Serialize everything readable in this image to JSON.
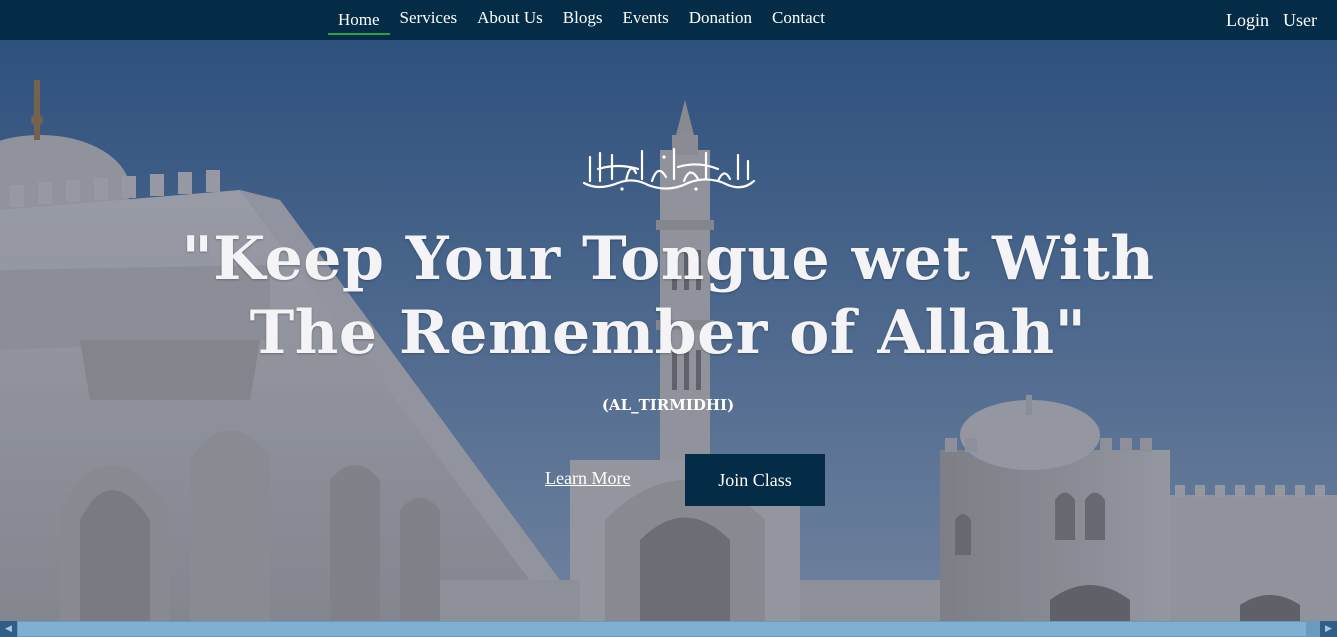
{
  "nav": {
    "items": [
      {
        "label": "Home",
        "active": true
      },
      {
        "label": "Services"
      },
      {
        "label": "About Us"
      },
      {
        "label": "Blogs"
      },
      {
        "label": "Events"
      },
      {
        "label": "Donation"
      },
      {
        "label": "Contact"
      }
    ],
    "login": "Login",
    "user": "User"
  },
  "hero": {
    "headline": "\"Keep Your Tongue wet With The Remember of Allah\"",
    "source": "(AL_TIRMIDHI)",
    "learn_more": "Learn More",
    "join_class": "Join Class",
    "calligraphy": "لا إله إلا الله محمد رسول الله"
  },
  "colors": {
    "navbar": "#052c46",
    "active_underline": "#2ea043",
    "button": "#052c46",
    "scrollbar": "#6a9bbf"
  }
}
